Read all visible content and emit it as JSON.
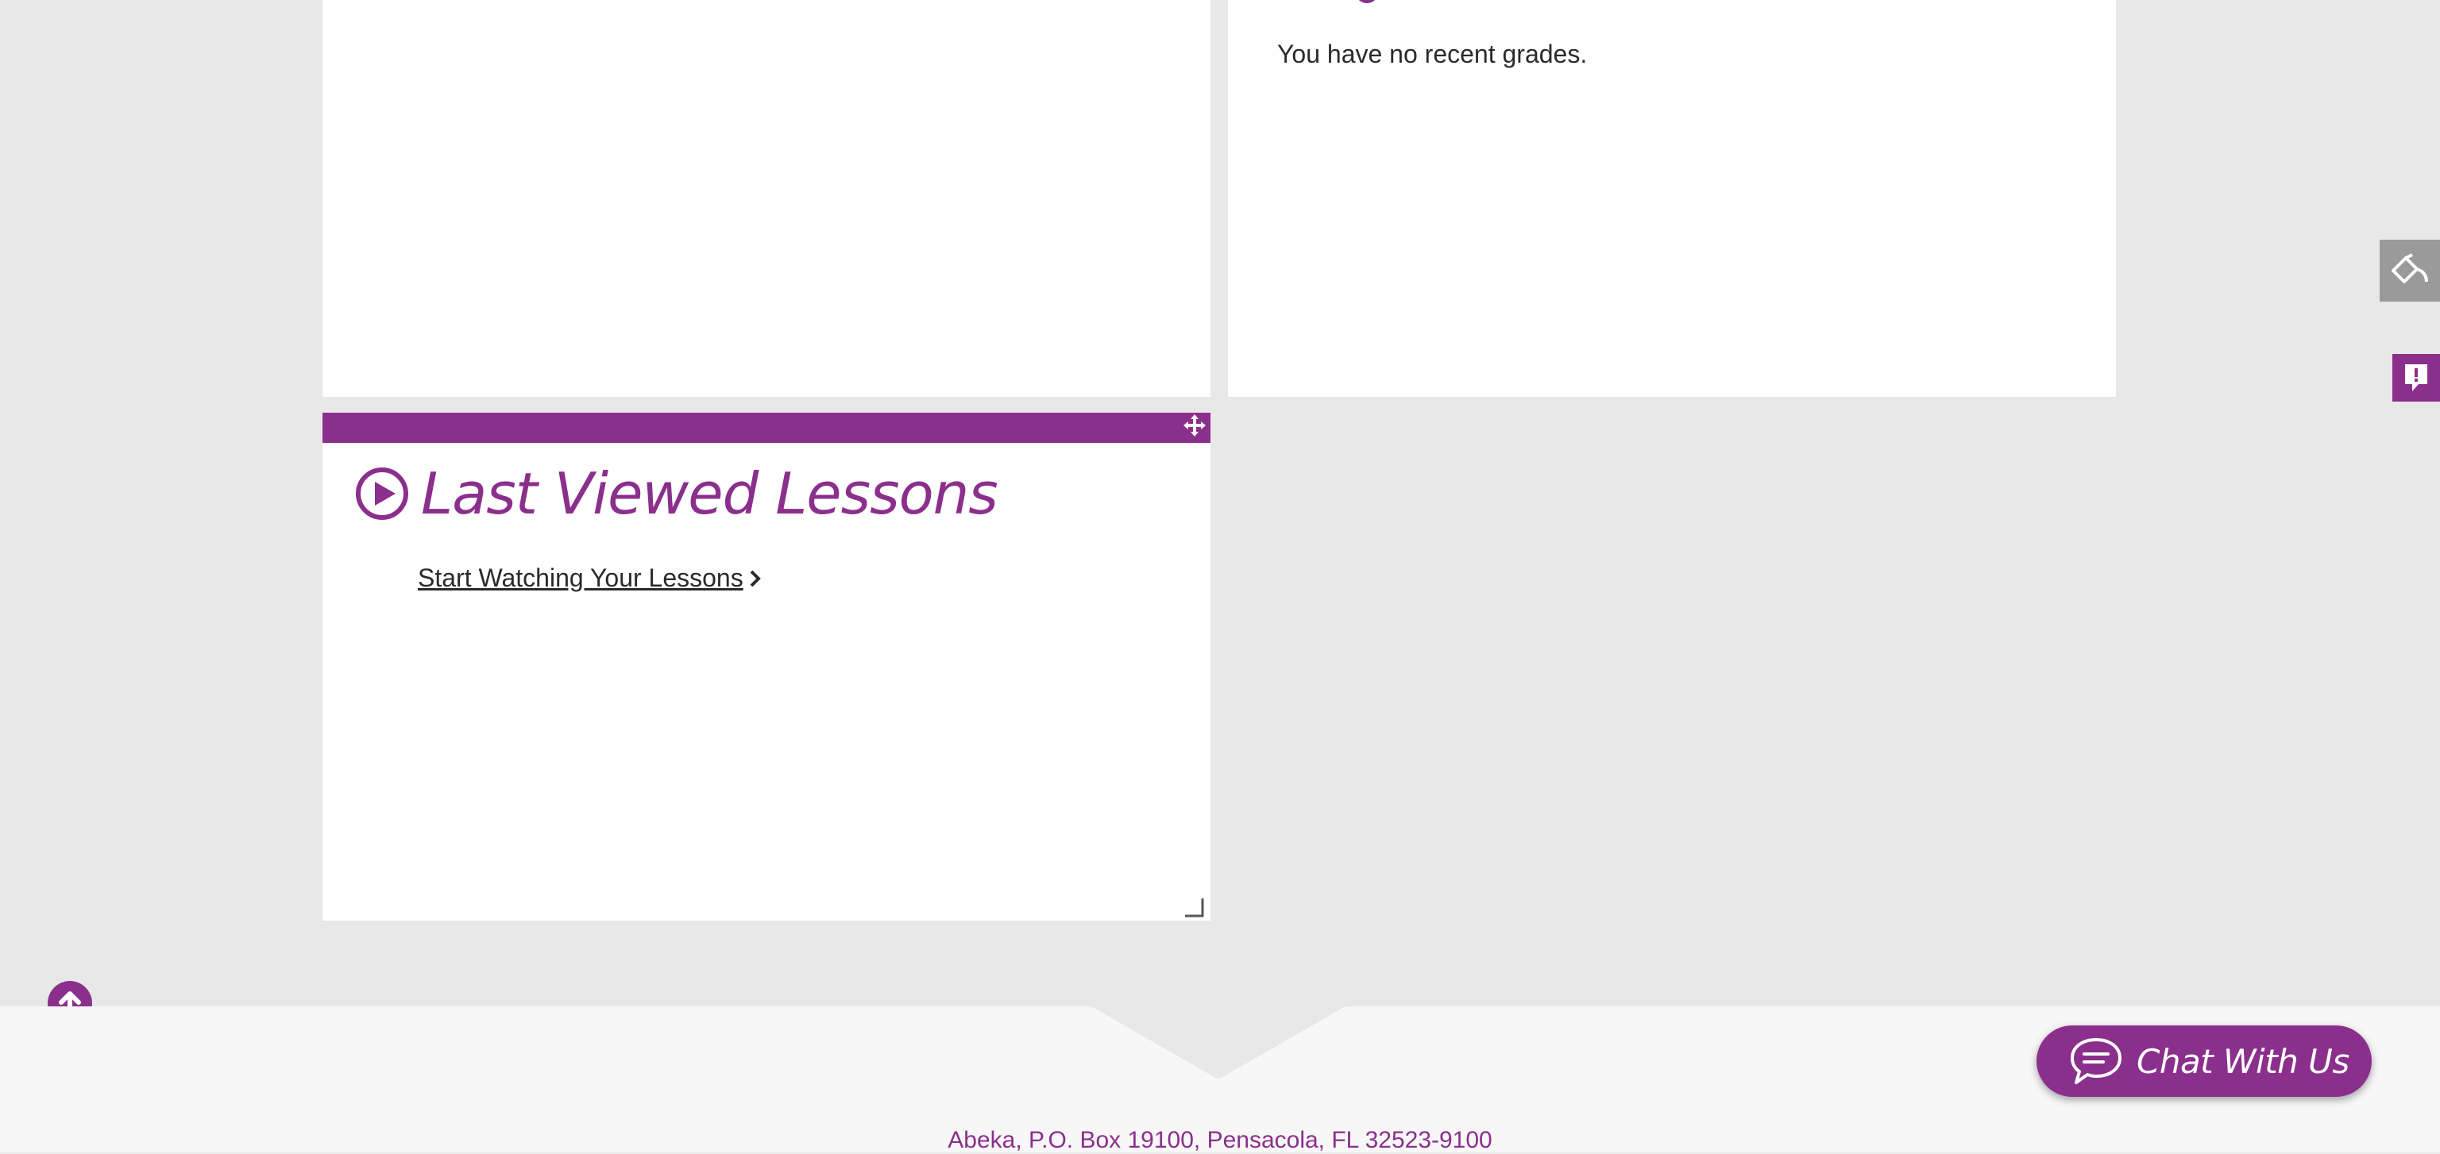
{
  "grades": {
    "empty_message": "You have no recent grades."
  },
  "lessons": {
    "title": "Last Viewed Lessons",
    "link_label": "Start Watching Your Lessons",
    "icon": "play-circle-icon"
  },
  "footer": {
    "address": "Abeka, P.O. Box 19100, Pensacola, FL  32523-9100"
  },
  "chat": {
    "label": "Chat With Us",
    "icon": "chat-bubble-icon"
  },
  "side_tools": {
    "tool1_icon": "paint-tool-icon",
    "tool2_icon": "feedback-icon"
  },
  "colors": {
    "brand": "#8b2f8c",
    "background": "#e8e8e8",
    "panel": "#ffffff",
    "footer": "#f7f7f7"
  }
}
